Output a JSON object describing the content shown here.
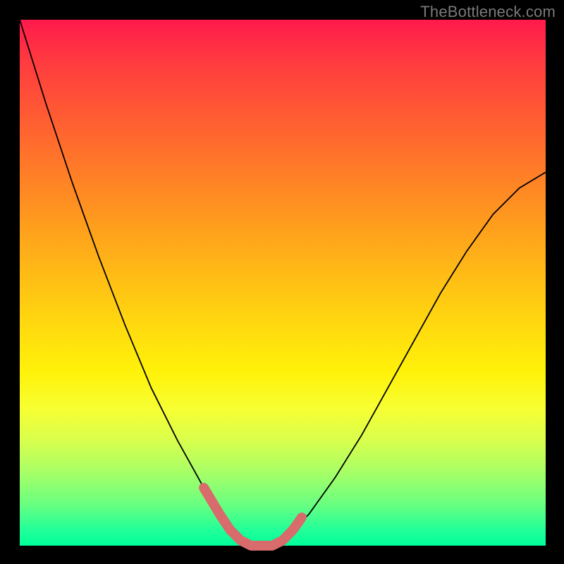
{
  "watermark": "TheBottleneck.com",
  "chart_data": {
    "type": "line",
    "title": "",
    "xlabel": "",
    "ylabel": "",
    "xlim": [
      0,
      100
    ],
    "ylim": [
      0,
      100
    ],
    "grid": false,
    "legend": false,
    "series": [
      {
        "name": "curve",
        "x": [
          0,
          5,
          10,
          15,
          20,
          25,
          30,
          35,
          38,
          40,
          42,
          44,
          46,
          48,
          50,
          55,
          60,
          65,
          70,
          75,
          80,
          85,
          90,
          95,
          100
        ],
        "y": [
          100,
          84,
          69,
          55,
          42,
          30,
          20,
          11,
          6,
          3,
          1,
          0,
          0,
          0,
          1,
          6,
          13,
          21,
          30,
          39,
          48,
          56,
          63,
          68,
          71
        ]
      }
    ],
    "highlight_range_x": [
      35,
      50
    ],
    "colors": {
      "curve": "#000000",
      "highlight": "#d86b6b",
      "gradient_top": "#ff1a4d",
      "gradient_mid": "#fff20a",
      "gradient_bottom": "#00ff99"
    }
  }
}
